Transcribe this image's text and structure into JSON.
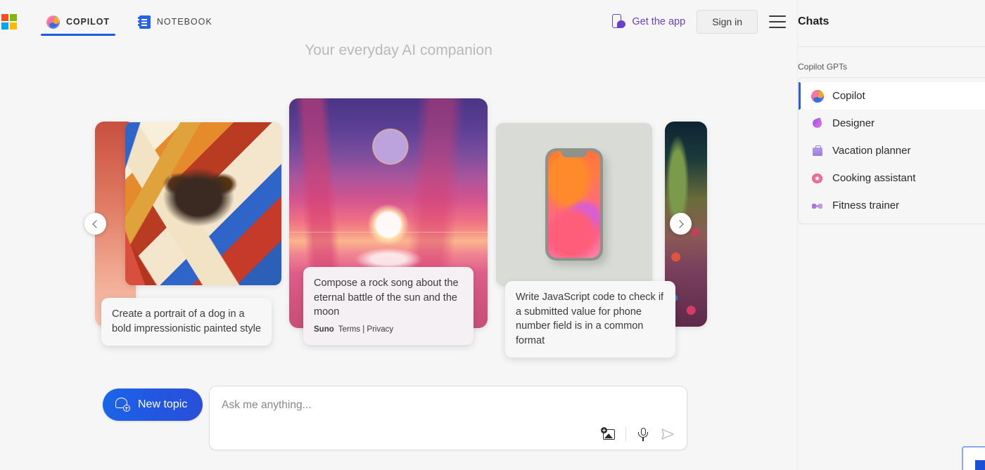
{
  "header": {
    "logo_name": "microsoft-logo",
    "tabs": [
      {
        "label": "COPILOT",
        "icon": "copilot-swirl-icon",
        "active": true
      },
      {
        "label": "NOTEBOOK",
        "icon": "notebook-icon",
        "active": false
      }
    ],
    "get_app_label": "Get the app",
    "get_app_icon": "phone-chat-icon",
    "sign_in_label": "Sign in",
    "menu_icon": "hamburger-menu-icon"
  },
  "hero": {
    "tagline": "Your everyday AI companion"
  },
  "carousel": {
    "prev_icon": "chevron-left-icon",
    "next_icon": "chevron-right-icon",
    "cards": [
      {
        "id": "card-partial-left",
        "caption": "",
        "art": "red-gradient-artwork"
      },
      {
        "id": "card-dog-portrait",
        "caption": "Create a portrait of a dog in a bold impressionistic painted style",
        "art": "impressionistic-dog-painting"
      },
      {
        "id": "card-sun-moon",
        "caption": "Compose a rock song about the eternal battle of the sun and the moon",
        "attribution_brand": "Suno",
        "attribution_links": "Terms | Privacy",
        "art": "sunset-moon-seascape"
      },
      {
        "id": "card-javascript-phone",
        "caption": "Write JavaScript code to check if a submitted value for phone number field is in a common format",
        "art": "smartphone-photo"
      },
      {
        "id": "card-partial-right",
        "caption": "",
        "art": "dark-floral-artwork"
      }
    ]
  },
  "composer": {
    "new_topic_label": "New topic",
    "new_topic_icon": "chat-plus-icon",
    "input_placeholder": "Ask me anything...",
    "input_value": "",
    "tools": [
      {
        "name": "add-image-icon",
        "label": "Add an image"
      },
      {
        "name": "microphone-icon",
        "label": "Use microphone"
      },
      {
        "name": "send-icon",
        "label": "Submit",
        "disabled": true
      }
    ]
  },
  "sidebar": {
    "title": "Chats",
    "section_label": "Copilot GPTs",
    "items": [
      {
        "label": "Copilot",
        "icon": "copilot-swirl-icon",
        "selected": true
      },
      {
        "label": "Designer",
        "icon": "designer-brush-icon",
        "selected": false
      },
      {
        "label": "Vacation planner",
        "icon": "suitcase-icon",
        "selected": false
      },
      {
        "label": "Cooking assistant",
        "icon": "donut-icon",
        "selected": false
      },
      {
        "label": "Fitness trainer",
        "icon": "dumbbell-icon",
        "selected": false
      }
    ]
  },
  "colors": {
    "accent_blue": "#2b5fe3",
    "purple_link": "#6b3fc9",
    "page_bg": "#f6f6f6",
    "focus_blue": "#8aa8ee"
  }
}
